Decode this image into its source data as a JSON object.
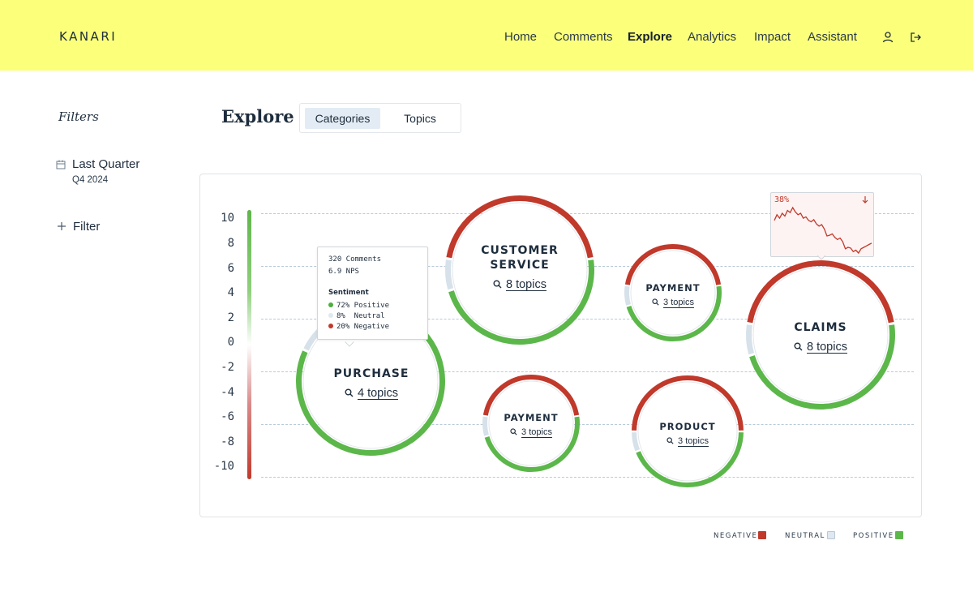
{
  "app": {
    "logo": "KANARI"
  },
  "nav": {
    "items": [
      {
        "label": "Home"
      },
      {
        "label": "Comments"
      },
      {
        "label": "Explore",
        "active": true
      },
      {
        "label": "Analytics"
      },
      {
        "label": "Impact"
      },
      {
        "label": "Assistant"
      }
    ],
    "icons": [
      "user-icon",
      "logout-icon"
    ]
  },
  "sidebar": {
    "title": "Filters",
    "period": {
      "label": "Last Quarter",
      "sub": "Q4 2024",
      "icon": "calendar-icon"
    },
    "add_filter": {
      "label": "Filter",
      "icon": "plus-icon"
    }
  },
  "main": {
    "title": "Explore",
    "tabs": [
      {
        "label": "Categories",
        "active": true
      },
      {
        "label": "Topics",
        "active": false
      }
    ]
  },
  "chart_data": {
    "type": "scatter",
    "y_axis": {
      "ticks": [
        "10",
        "8",
        "6",
        "4",
        "2",
        "0",
        "-2",
        "-4",
        "-6",
        "-8",
        "-10"
      ],
      "ylim": [
        -10,
        10
      ]
    },
    "grid": true,
    "bubbles": [
      {
        "label": "PURCHASE",
        "topics": "4 topics",
        "negative": 20,
        "neutral": 8,
        "positive": 72
      },
      {
        "label": "CUSTOMER SERVICE",
        "topics": "8 topics",
        "negative": 45,
        "neutral": 7,
        "positive": 48
      },
      {
        "label": "PAYMENT",
        "topics": "3 topics",
        "negative": 45,
        "neutral": 7,
        "positive": 48
      },
      {
        "label": "PAYMENT",
        "topics": "3 topics",
        "negative": 45,
        "neutral": 7,
        "positive": 48
      },
      {
        "label": "PRODUCT",
        "topics": "3 topics",
        "negative": 50,
        "neutral": 6,
        "positive": 44
      },
      {
        "label": "CLAIMS",
        "topics": "8 topics",
        "negative": 45,
        "neutral": 7,
        "positive": 48
      }
    ],
    "tooltip": {
      "comments": "320 Comments",
      "nps": "6.9 NPS",
      "heading": "Sentiment",
      "rows": [
        {
          "text": "72% Positive",
          "color": "#4caf3f"
        },
        {
          "text": "8%  Neutral",
          "color": "#dfe8f0"
        },
        {
          "text": "20% Negative",
          "color": "#c0392b"
        }
      ]
    },
    "sparkline": {
      "value": "38%",
      "trend": "down",
      "points": [
        52,
        60,
        55,
        62,
        58,
        66,
        63,
        70,
        64,
        60,
        62,
        55,
        57,
        52,
        50,
        53,
        47,
        44,
        46,
        40,
        30,
        31,
        33,
        28,
        25,
        27,
        22,
        12,
        14,
        13,
        8,
        10,
        6,
        12,
        14,
        16,
        18,
        20
      ]
    },
    "legend": [
      {
        "label": "NEGATIVE",
        "color": "#c0392b"
      },
      {
        "label": "NEUTRAL",
        "color": "#dfe8f0"
      },
      {
        "label": "POSITIVE",
        "color": "#5cb74a"
      }
    ]
  }
}
